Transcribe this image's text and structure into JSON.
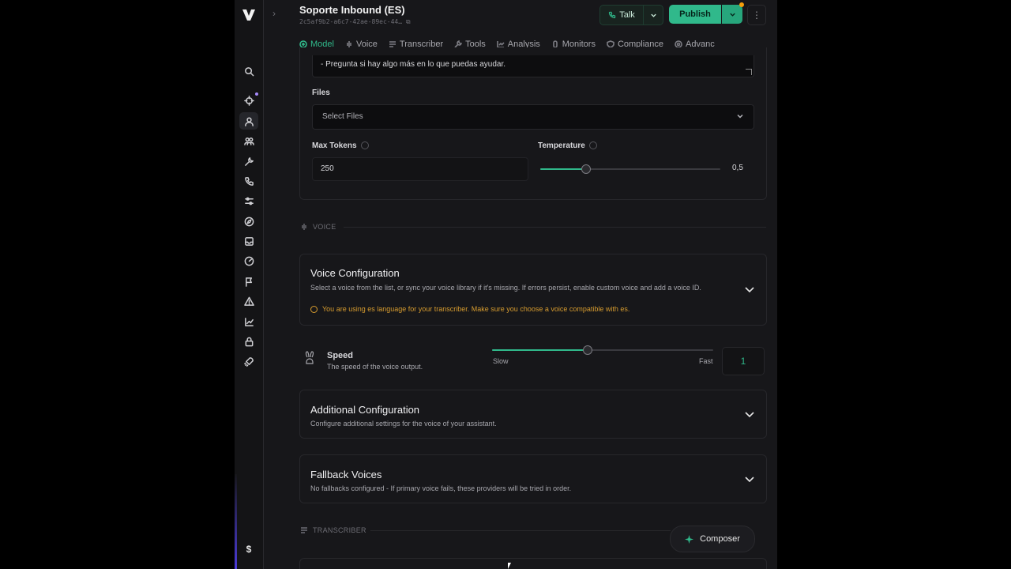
{
  "assistant": {
    "name": "Soporte Inbound (ES)",
    "id": "2c5af9b2-a6c7-42ae-89ec-44…"
  },
  "header": {
    "talk_label": "Talk",
    "publish_label": "Publish"
  },
  "tabs": [
    {
      "label": "Model",
      "icon": "model-icon",
      "active": true
    },
    {
      "label": "Voice",
      "icon": "voice-icon"
    },
    {
      "label": "Transcriber",
      "icon": "transcriber-icon"
    },
    {
      "label": "Tools",
      "icon": "tools-icon"
    },
    {
      "label": "Analysis",
      "icon": "analysis-icon"
    },
    {
      "label": "Monitors",
      "icon": "monitors-icon"
    },
    {
      "label": "Compliance",
      "icon": "compliance-icon"
    },
    {
      "label": "Advanc",
      "icon": "advanced-icon"
    }
  ],
  "model": {
    "prompt_last_line": "- Pregunta si hay algo más en lo que puedas ayudar.",
    "files_label": "Files",
    "files_placeholder": "Select Files",
    "max_tokens_label": "Max Tokens",
    "max_tokens_value": "250",
    "temperature_label": "Temperature",
    "temperature_value": "0,5",
    "temperature_fraction": 0.25
  },
  "voice_section": {
    "header": "VOICE",
    "config_title": "Voice Configuration",
    "config_desc": "Select a voice from the list, or sync your voice library if it's missing. If errors persist, enable custom voice and add a voice ID.",
    "config_warning": "You are using es language for your transcriber. Make sure you choose a voice compatible with es.",
    "speed_title": "Speed",
    "speed_desc": "The speed of the voice output.",
    "speed_slow": "Slow",
    "speed_fast": "Fast",
    "speed_value": "1",
    "speed_fraction": 0.43,
    "additional_title": "Additional Configuration",
    "additional_desc": "Configure additional settings for the voice of your assistant.",
    "fallback_title": "Fallback Voices",
    "fallback_desc": "No fallbacks configured - If primary voice fails, these providers will be tried in order."
  },
  "transcriber_section": {
    "header": "TRANSCRIBER"
  },
  "composer_label": "Composer",
  "sidebar": {
    "icons": [
      "search-icon",
      "assistants-icon",
      "user-icon",
      "squads-icon",
      "tools-icon",
      "phone-icon",
      "settings-sliders-icon",
      "compass-icon",
      "inbox-icon",
      "gauge-icon",
      "flag-icon",
      "alert-icon",
      "chart-icon",
      "lock-icon",
      "rocket-icon"
    ],
    "dollar": "$"
  },
  "colors": {
    "accent": "#30b98b",
    "warning": "#d79c2f",
    "background": "#17171a"
  }
}
